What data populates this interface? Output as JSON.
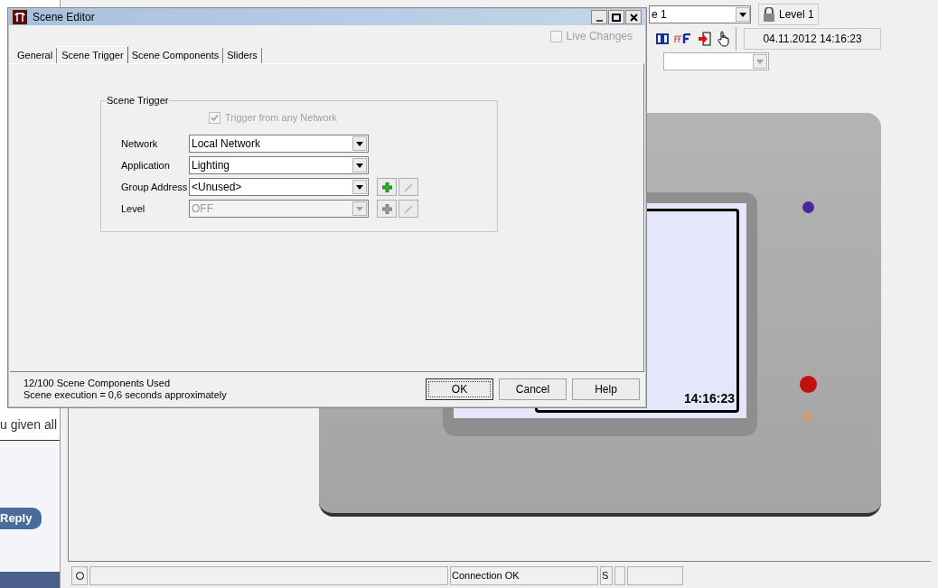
{
  "browser_fragment": {
    "text": "u given all",
    "reply_button": "Reply"
  },
  "app": {
    "toolbar": {
      "page_combo": "e 1",
      "level_button": "Level 1",
      "datetime": "04.11.2012 14:16:23"
    },
    "device": {
      "clock": "14:16:23"
    },
    "status_bar": {
      "connection": "Connection OK",
      "mode": "S"
    }
  },
  "dialog": {
    "title": "Scene Editor",
    "tabs": [
      {
        "label": "General",
        "selected": false
      },
      {
        "label": "Scene Trigger",
        "selected": true
      },
      {
        "label": "Scene Components",
        "selected": false
      },
      {
        "label": "Sliders",
        "selected": false
      }
    ],
    "live_changes": {
      "label": "Live Changes",
      "checked": false,
      "disabled": true
    },
    "group": {
      "title": "Scene Trigger",
      "trigger_any": {
        "label": "Trigger from any Network",
        "checked": true,
        "disabled": true
      },
      "fields": [
        {
          "kind": "plain",
          "label": "Network",
          "value": "Local Network",
          "disabled": false
        },
        {
          "kind": "plain",
          "label": "Application",
          "value": "Lighting",
          "disabled": false
        },
        {
          "kind": "actions",
          "label": "Group Address",
          "value": "<Unused>",
          "disabled": false,
          "add_enabled": true
        },
        {
          "kind": "actions",
          "label": "Level",
          "value": "OFF",
          "disabled": true,
          "add_enabled": false
        }
      ]
    },
    "summary": [
      "12/100 Scene Components Used",
      "Scene execution = 0,6 seconds approximately"
    ],
    "buttons": [
      {
        "label": "OK",
        "default": true
      },
      {
        "label": "Cancel",
        "default": false
      },
      {
        "label": "Help",
        "default": false
      }
    ]
  }
}
